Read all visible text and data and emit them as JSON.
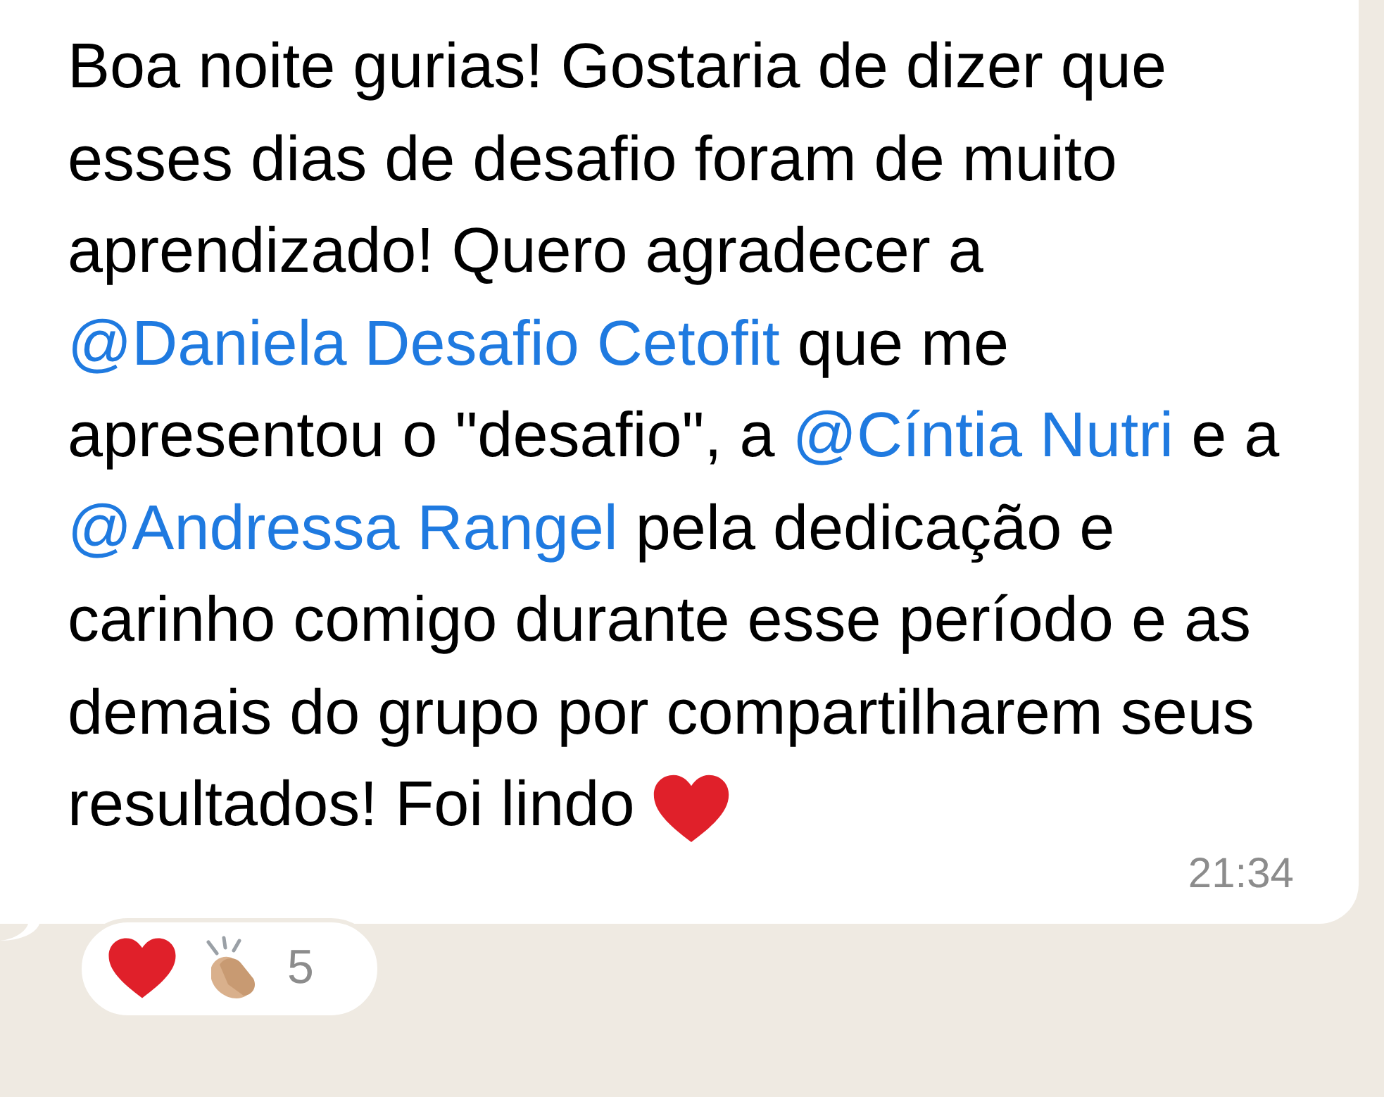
{
  "message": {
    "segments": [
      {
        "kind": "text",
        "text": "Boa noite gurias! Gostaria de dizer que esses dias de desafio foram de muito aprendizado! Quero agradecer a "
      },
      {
        "kind": "mention",
        "text": "@Daniela Desafio Cetofit"
      },
      {
        "kind": "text",
        "text": " que me apresentou o \"desafio\", a "
      },
      {
        "kind": "mention",
        "text": "@Cíntia Nutri"
      },
      {
        "kind": "text",
        "text": " e a "
      },
      {
        "kind": "mention",
        "text": "@Andressa Rangel"
      },
      {
        "kind": "text",
        "text": " pela dedicação e carinho comigo durante esse período e as demais do grupo por compartilharem seus resultados! Foi lindo"
      }
    ],
    "time": "21:34",
    "reactions": {
      "count": "5"
    }
  }
}
